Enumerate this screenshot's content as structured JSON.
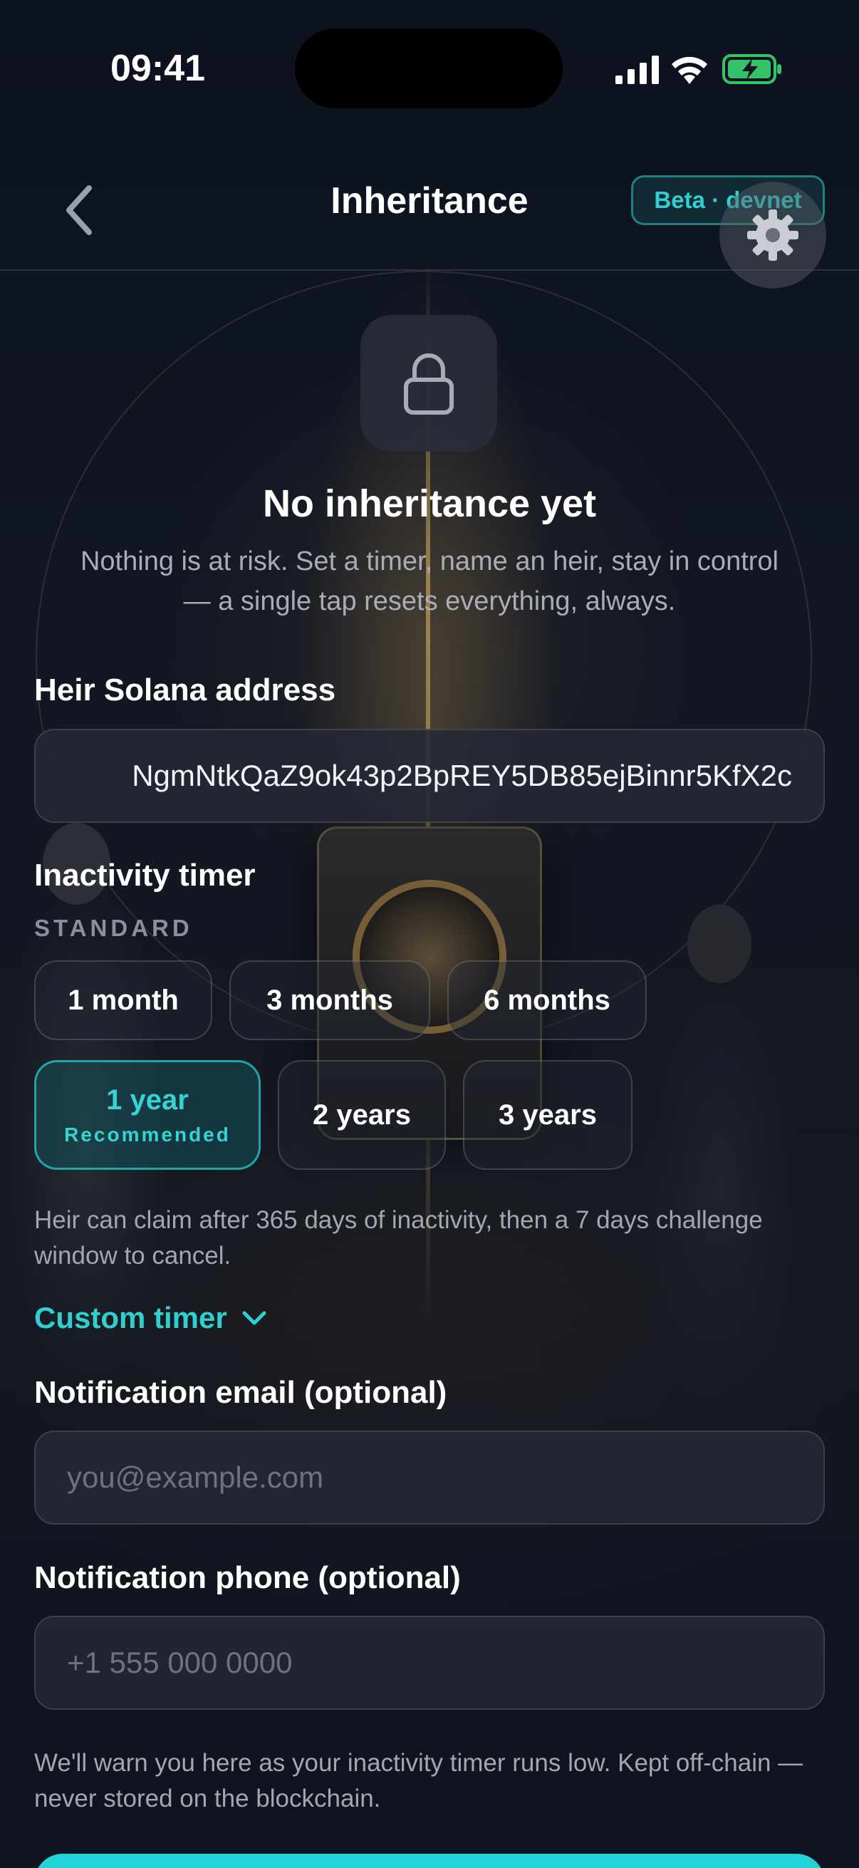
{
  "status_bar": {
    "time": "09:41"
  },
  "nav": {
    "title": "Inheritance",
    "badge": "Beta · devnet"
  },
  "empty_state": {
    "title": "No inheritance yet",
    "description": "Nothing is at risk. Set a timer, name an heir, stay in control — a single tap resets everything, always."
  },
  "heir": {
    "label": "Heir Solana address",
    "value": "NgmNtkQaZ9ok43p2BpREY5DB85ejBinnr5KfX2c"
  },
  "timer": {
    "label": "Inactivity timer",
    "section": "STANDARD",
    "options": [
      {
        "label": "1 month"
      },
      {
        "label": "3 months"
      },
      {
        "label": "6 months"
      },
      {
        "label": "1 year",
        "sub": "Recommended",
        "selected": true
      },
      {
        "label": "2 years"
      },
      {
        "label": "3 years"
      }
    ],
    "helper": "Heir can claim after 365 days of inactivity, then a 7 days challenge window to cancel.",
    "custom_label": "Custom timer"
  },
  "email": {
    "label": "Notification email (optional)",
    "placeholder": "you@example.com"
  },
  "phone": {
    "label": "Notification phone (optional)",
    "placeholder": "+1 555 000 0000"
  },
  "notice": "We'll warn you here as your inactivity timer runs low. Kept off-chain — never stored on the blockchain.",
  "colors": {
    "accent": "#2fd0d0",
    "background": "#0f1420"
  }
}
